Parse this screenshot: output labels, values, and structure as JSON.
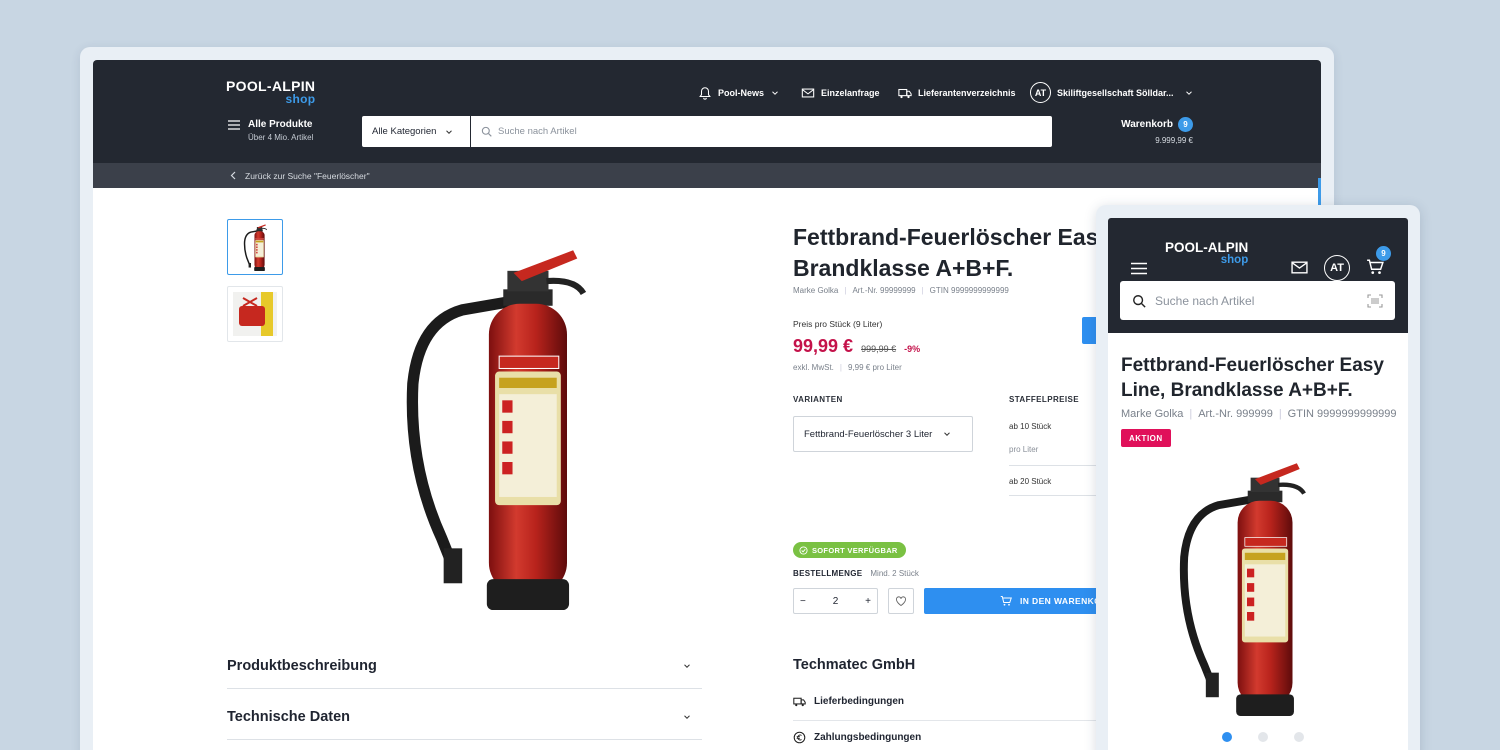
{
  "brand": {
    "name": "POOL-ALPIN",
    "sub": "shop"
  },
  "topnav": {
    "news": "Pool-News",
    "request": "Einzelanfrage",
    "suppliers": "Lieferantenverzeichnis",
    "avatar": "AT",
    "company": "Skiliftgesellschaft Sölldar..."
  },
  "menu": {
    "label": "Alle Produkte",
    "sub": "Über 4 Mio. Artikel"
  },
  "search": {
    "category": "Alle Kategorien",
    "placeholder": "Suche nach Artikel"
  },
  "cart": {
    "label": "Warenkorb",
    "count": "9",
    "amount": "9.999,99 €"
  },
  "breadcrumb": "Zurück zur Suche \"Feuerlöscher\"",
  "product": {
    "title_line1": "Fettbrand-Feuerlöscher Eas",
    "title_line2": "Brandklasse A+B+F.",
    "brand": "Marke Golka",
    "art_nr": "Art.-Nr. 99999999",
    "gtin": "GTIN 9999999999999",
    "price_label": "Preis pro Stück (9 Liter)",
    "price": "99,99 €",
    "old_price": "999,99 €",
    "discount": "-9%",
    "tax": "exkl. MwSt.",
    "unit_price": "9,99 € pro Liter",
    "variants_label": "VARIANTEN",
    "variant": "Fettbrand-Feuerlöscher 3 Liter",
    "tier_label": "STAFFELPREISE",
    "tier1": "ab 10 Stück",
    "tier1_sub": "pro Liter",
    "tier2": "ab 20 Stück",
    "availability": "SOFORT VERFÜGBAR",
    "min_order_label": "BESTELLMENGE",
    "min_order": "Mind. 2 Stück",
    "qty": "2",
    "add_to_cart": "IN DEN WARENKO"
  },
  "accordions": [
    "Produktbeschreibung",
    "Technische Daten"
  ],
  "vendor": {
    "name": "Techmatec GmbH",
    "delivery": "Lieferbedingungen",
    "payment": "Zahlungsbedingungen"
  },
  "mobile": {
    "avatar": "AT",
    "cart_count": "9",
    "search_placeholder": "Suche nach Artikel",
    "title": "Fettbrand-Feuerlöscher Easy Line, Brandklasse A+B+F.",
    "brand": "Marke Golka",
    "art_nr": "Art.-Nr. 999999",
    "gtin": "GTIN 9999999999999",
    "badge": "AKTION"
  },
  "colors": {
    "header": "#232831",
    "accent": "#2e8ff0",
    "price": "#c4124a",
    "available": "#7ac143",
    "aktion": "#e0105a"
  }
}
